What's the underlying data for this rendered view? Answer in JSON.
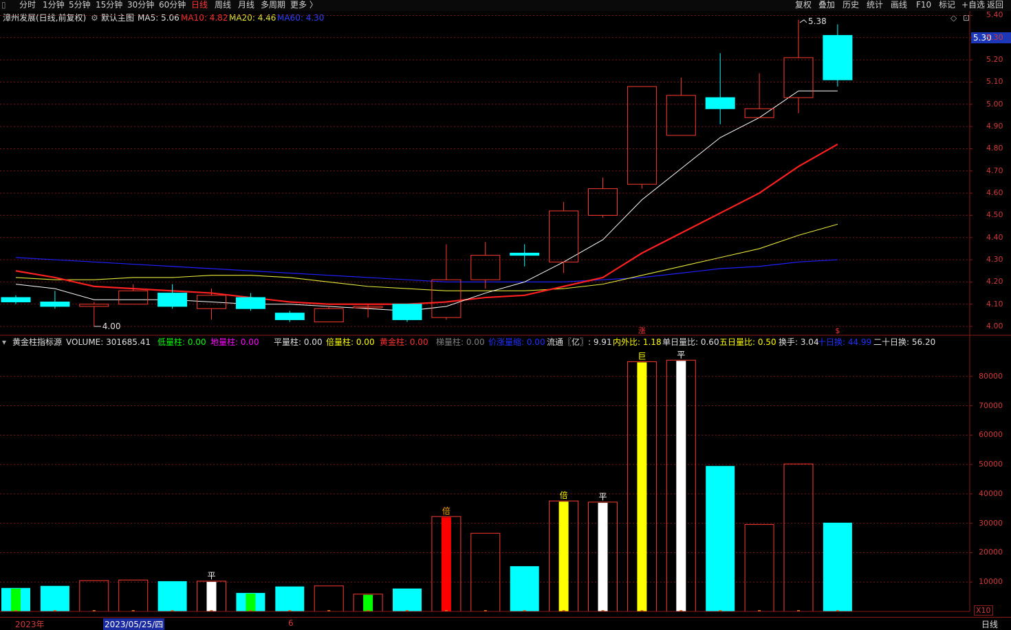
{
  "toolbar": {
    "periods": [
      "分时",
      "1分钟",
      "5分钟",
      "15分钟",
      "30分钟",
      "60分钟",
      "日线",
      "周线",
      "月线",
      "多周期",
      "更多 〉"
    ],
    "active_period": "日线",
    "right_buttons": [
      "复权",
      "叠加",
      "历史",
      "统计",
      "画线",
      "F10",
      "标记",
      "+自选",
      "返回"
    ]
  },
  "main_info": {
    "stock": "漳州发展(日线,前复权)",
    "template": "默认主图",
    "ma5": "MA5: 5.06",
    "ma10": "MA10: 4.82",
    "ma20": "MA20: 4.46",
    "ma60": "MA60: 4.30"
  },
  "colors": {
    "up": "#ff3b30",
    "down": "#00ffff",
    "ma5": "#ffffff",
    "ma10": "#ff2020",
    "ma20": "#e8e83a",
    "ma60": "#2020ff",
    "grid": "#7a1515",
    "axis": "#8b1a1a"
  },
  "price_axis": {
    "ticks": [
      "5.40",
      "5.30",
      "5.20",
      "5.10",
      "5.00",
      "4.90",
      "4.80",
      "4.70",
      "4.60",
      "4.50",
      "4.40",
      "4.30",
      "4.20",
      "4.10",
      "4.00"
    ],
    "current_price": "5.30",
    "high_label": "5.38",
    "low_label": "4.00"
  },
  "chart_data": {
    "type": "candlestick",
    "ylim": [
      3.96,
      5.42
    ],
    "candles": [
      {
        "o": 4.13,
        "c": 4.11,
        "h": 4.14,
        "l": 4.1
      },
      {
        "o": 4.11,
        "c": 4.09,
        "h": 4.16,
        "l": 4.08
      },
      {
        "o": 4.09,
        "c": 4.1,
        "h": 4.11,
        "l": 4.0
      },
      {
        "o": 4.1,
        "c": 4.16,
        "h": 4.19,
        "l": 4.1
      },
      {
        "o": 4.15,
        "c": 4.09,
        "h": 4.19,
        "l": 4.08
      },
      {
        "o": 4.08,
        "c": 4.14,
        "h": 4.17,
        "l": 4.03
      },
      {
        "o": 4.13,
        "c": 4.08,
        "h": 4.15,
        "l": 4.07
      },
      {
        "o": 4.06,
        "c": 4.03,
        "h": 4.07,
        "l": 4.02
      },
      {
        "o": 4.02,
        "c": 4.08,
        "h": 4.09,
        "l": 4.02
      },
      {
        "o": 4.09,
        "c": 4.09,
        "h": 4.1,
        "l": 4.04
      },
      {
        "o": 4.1,
        "c": 4.03,
        "h": 4.1,
        "l": 4.02
      },
      {
        "o": 4.04,
        "c": 4.21,
        "h": 4.37,
        "l": 4.03
      },
      {
        "o": 4.21,
        "c": 4.32,
        "h": 4.38,
        "l": 4.17
      },
      {
        "o": 4.33,
        "c": 4.32,
        "h": 4.37,
        "l": 4.27
      },
      {
        "o": 4.29,
        "c": 4.52,
        "h": 4.56,
        "l": 4.24
      },
      {
        "o": 4.5,
        "c": 4.62,
        "h": 4.67,
        "l": 4.49
      },
      {
        "o": 4.64,
        "c": 5.08,
        "h": 5.08,
        "l": 4.62
      },
      {
        "o": 4.86,
        "c": 5.04,
        "h": 5.12,
        "l": 4.86
      },
      {
        "o": 5.03,
        "c": 4.98,
        "h": 5.23,
        "l": 4.91
      },
      {
        "o": 4.94,
        "c": 4.98,
        "h": 5.14,
        "l": 4.94
      },
      {
        "o": 5.03,
        "c": 5.21,
        "h": 5.38,
        "l": 4.96
      },
      {
        "o": 5.31,
        "c": 5.11,
        "h": 5.36,
        "l": 5.08
      }
    ],
    "ma5": [
      4.19,
      4.17,
      4.12,
      4.12,
      4.12,
      4.11,
      4.1,
      4.1,
      4.09,
      4.08,
      4.07,
      4.09,
      4.15,
      4.2,
      4.29,
      4.39,
      4.57,
      4.71,
      4.85,
      4.94,
      5.06,
      5.06
    ],
    "ma10": [
      4.25,
      4.22,
      4.18,
      4.17,
      4.16,
      4.15,
      4.13,
      4.11,
      4.1,
      4.1,
      4.1,
      4.11,
      4.13,
      4.14,
      4.18,
      4.22,
      4.33,
      4.42,
      4.51,
      4.6,
      4.72,
      4.82
    ],
    "ma20": [
      4.22,
      4.21,
      4.21,
      4.22,
      4.22,
      4.23,
      4.23,
      4.22,
      4.2,
      4.18,
      4.17,
      4.16,
      4.16,
      4.16,
      4.17,
      4.19,
      4.23,
      4.27,
      4.31,
      4.35,
      4.41,
      4.46
    ],
    "ma60": [
      4.31,
      4.3,
      4.29,
      4.28,
      4.27,
      4.26,
      4.25,
      4.24,
      4.23,
      4.22,
      4.21,
      4.2,
      4.2,
      4.2,
      4.2,
      4.21,
      4.22,
      4.24,
      4.26,
      4.27,
      4.29,
      4.3
    ],
    "volume": [
      8000,
      8700,
      10500,
      10700,
      10300,
      10300,
      6300,
      8500,
      8700,
      5900,
      7800,
      32300,
      26600,
      15400,
      37600,
      37200,
      85000,
      85500,
      49500,
      29600,
      50200,
      30200
    ],
    "vol_ylim": [
      0,
      90000
    ],
    "vol_bars": [
      {
        "kind": "cyan",
        "mark": "green"
      },
      {
        "kind": "cyan",
        "mark": ""
      },
      {
        "kind": "hollow",
        "mark": ""
      },
      {
        "kind": "hollow",
        "mark": ""
      },
      {
        "kind": "cyan",
        "mark": ""
      },
      {
        "kind": "hollow",
        "mark": "white"
      },
      {
        "kind": "cyan",
        "mark": "green"
      },
      {
        "kind": "cyan",
        "mark": ""
      },
      {
        "kind": "hollow",
        "mark": ""
      },
      {
        "kind": "hollow",
        "mark": "green"
      },
      {
        "kind": "cyan",
        "mark": ""
      },
      {
        "kind": "hollow",
        "mark": "red"
      },
      {
        "kind": "hollow",
        "mark": ""
      },
      {
        "kind": "cyan",
        "mark": ""
      },
      {
        "kind": "hollow",
        "mark": "yellow"
      },
      {
        "kind": "hollow",
        "mark": "white"
      },
      {
        "kind": "hollow",
        "mark": "yellow"
      },
      {
        "kind": "hollow",
        "mark": "white"
      },
      {
        "kind": "cyan",
        "mark": ""
      },
      {
        "kind": "hollow",
        "mark": ""
      },
      {
        "kind": "hollow",
        "mark": ""
      },
      {
        "kind": "cyan",
        "mark": ""
      }
    ],
    "vol_labels": [
      {
        "i": 5,
        "text": "平",
        "color": "#ffffff"
      },
      {
        "i": 11,
        "text": "倍",
        "color": "#ffaa00"
      },
      {
        "i": 14,
        "text": "倍",
        "color": "#ffff00"
      },
      {
        "i": 15,
        "text": "平",
        "color": "#ffffff"
      },
      {
        "i": 16,
        "text": "巨",
        "color": "#ffff00"
      },
      {
        "i": 17,
        "text": "平",
        "color": "#ffffff"
      }
    ],
    "event_marks": [
      {
        "i": 16,
        "text": "涨",
        "color": "#ff3030"
      },
      {
        "i": 21,
        "text": "$",
        "color": "#ff3030"
      }
    ]
  },
  "vol_info": {
    "title": "黄金柱指标源",
    "items": [
      {
        "text": "VOLUME: 301685.41",
        "color": "#e0e0e0"
      },
      {
        "text": "低量柱: 0.00",
        "color": "#00ff00"
      },
      {
        "text": "地量柱: 0.00",
        "color": "#ff00ff"
      },
      {
        "text": "平量柱: 0.00",
        "color": "#e0e0e0"
      },
      {
        "text": "倍量柱: 0.00",
        "color": "#ffff00"
      },
      {
        "text": "黄金柱: 0.00",
        "color": "#ff3030"
      },
      {
        "text": "梯量柱: 0.00",
        "color": "#808080"
      },
      {
        "text": "价涨量缩: 0.00",
        "color": "#2030ff"
      },
      {
        "text": "流通〖亿〗: 9.91",
        "color": "#e0e0e0"
      },
      {
        "text": "内外比: 1.18",
        "color": "#ffff00"
      },
      {
        "text": "单日量比: 0.60",
        "color": "#e0e0e0"
      },
      {
        "text": "五日量比: 0.50",
        "color": "#ffff00"
      },
      {
        "text": "换手: 3.04",
        "color": "#e0e0e0"
      },
      {
        "text": "十日换: 44.99",
        "color": "#2030ff"
      },
      {
        "text": "二十日换: 56.20",
        "color": "#e0e0e0"
      }
    ]
  },
  "volume_axis": {
    "ticks": [
      "80000",
      "70000",
      "60000",
      "50000",
      "40000",
      "30000",
      "20000",
      "10000"
    ],
    "unit": "X10"
  },
  "bottom_axis": {
    "year_label": "2023年",
    "selected_date": "2023/05/25/四",
    "month_label": "6",
    "period_label": "日线"
  }
}
